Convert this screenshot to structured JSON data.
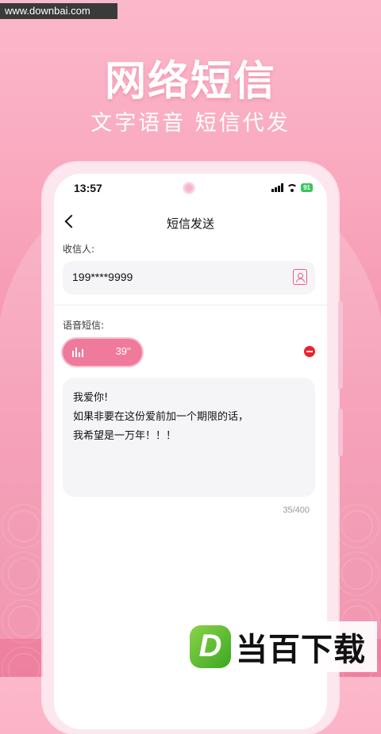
{
  "watermark": "www.downbai.com",
  "hero": {
    "title": "网络短信",
    "subtitle": "文字语音 短信代发"
  },
  "status_bar": {
    "time": "13:57",
    "battery": "91"
  },
  "nav": {
    "title": "短信发送",
    "back_icon": "chevron-left-icon"
  },
  "recipient": {
    "label": "收信人:",
    "value": "199****9999",
    "contact_icon": "contact-card-icon"
  },
  "voice": {
    "label": "语音短信:",
    "duration": "39''"
  },
  "message": {
    "lines": [
      "我爱你!",
      "如果非要在这份爱前加一个期限的话，",
      "我希望是一万年！！！"
    ],
    "counter": "35/400"
  },
  "brand": {
    "logo_letter": "D",
    "logo_text": "当百下载"
  },
  "colors": {
    "accent": "#f07a9b",
    "background_top": "#fcb8cb",
    "delete": "#e8242f"
  }
}
